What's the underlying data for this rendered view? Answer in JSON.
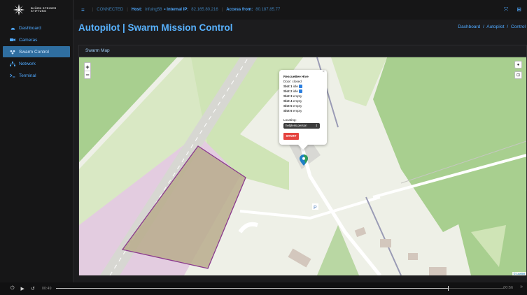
{
  "org": {
    "logo_text": "BJÖRN STEIGER STIFTUNG"
  },
  "sidebar": {
    "items": [
      {
        "label": "Dashboard",
        "icon": "dashboard-icon",
        "active": false
      },
      {
        "label": "Cameras",
        "icon": "camera-icon",
        "active": false
      },
      {
        "label": "Swarm Control",
        "icon": "swarm-icon",
        "active": true
      },
      {
        "label": "Network",
        "icon": "network-icon",
        "active": false
      },
      {
        "label": "Terminal",
        "icon": "terminal-icon",
        "active": false
      }
    ]
  },
  "topbar": {
    "status": "CONNECTED",
    "host_label": "Host:",
    "host_value": "infuing58",
    "internal_ip_label": "• Internal IP:",
    "internal_ip_value": "82.165.80.216",
    "access_label": "Access from:",
    "access_value": "80.187.85.77"
  },
  "header": {
    "title": "Autopilot | Swarm Mission Control",
    "breadcrumb": [
      "Dashboard",
      "Autopilot",
      "Control"
    ]
  },
  "card": {
    "title": "Swarm Map"
  },
  "map": {
    "zoom_in": "+",
    "zoom_out": "−",
    "attribution": "© Leaflet",
    "popup": {
      "title": "RescueBee Hive",
      "door": "Door: closed",
      "slots": [
        {
          "name": "Slot 1",
          "status": "idle",
          "checked": true
        },
        {
          "name": "Slot 2",
          "status": "idle",
          "checked": true
        },
        {
          "name": "Slot 3",
          "status": "empty",
          "checked": false
        },
        {
          "name": "Slot 4",
          "status": "empty",
          "checked": false
        },
        {
          "name": "Slot 5",
          "status": "empty",
          "checked": false
        },
        {
          "name": "Slot 6",
          "status": "empty",
          "checked": false
        }
      ],
      "locating_label": "Locating:",
      "locating_value": "helpless person",
      "start_label": "START",
      "close": "×"
    }
  },
  "video": {
    "current_time": "00:49",
    "duration": "00:56",
    "progress": 0.875
  },
  "colors": {
    "accent": "#4fa9ff",
    "active_nav": "#2f6ea0",
    "start": "#e5433f",
    "zone_fill": "#b8ab8c",
    "zone_stroke": "#8b3a8e"
  }
}
